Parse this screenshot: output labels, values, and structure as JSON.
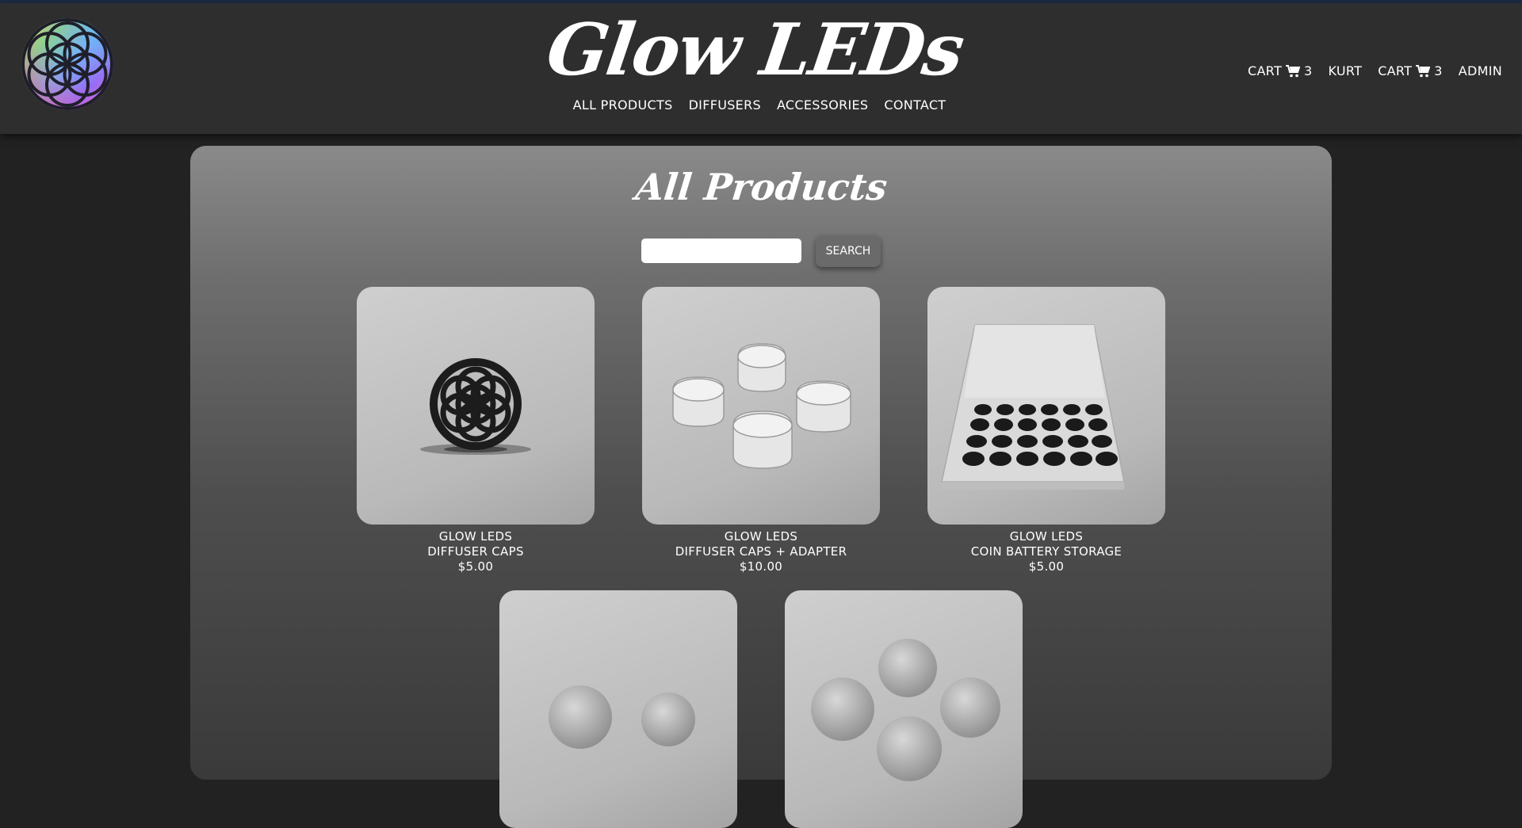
{
  "header": {
    "brand": "Glow LEDs",
    "main_nav": [
      "All Products",
      "Diffusers",
      "Accessories",
      "Contact"
    ],
    "right_nav": {
      "cart1_label": "CART",
      "cart1_count": "3",
      "user": "KURT",
      "cart2_label": "CART",
      "cart2_count": "3",
      "admin": "ADMIN"
    }
  },
  "page": {
    "title": "All Products",
    "search": {
      "value": "",
      "button": "Search"
    }
  },
  "products": [
    {
      "brand": "Glow LEDs",
      "name": "Diffuser Caps",
      "price": "$5.00",
      "image": "single-diffuser-cap-flower-of-life"
    },
    {
      "brand": "Glow LEDs",
      "name": "Diffuser Caps + Adapter",
      "price": "$10.00",
      "image": "four-diffuser-caps"
    },
    {
      "brand": "Glow LEDs",
      "name": "Coin Battery Storage",
      "price": "$5.00",
      "image": "coin-battery-storage-tray"
    },
    {
      "brand": "",
      "name": "",
      "price": "",
      "image": "two-spheres"
    },
    {
      "brand": "",
      "name": "",
      "price": "",
      "image": "five-spheres"
    }
  ],
  "colors": {
    "page_bg": "#222222",
    "header_bg": "#2e2e2e",
    "content_top": "#8a8a8a",
    "content_bottom": "#3a3a3a",
    "text": "#ffffff"
  }
}
